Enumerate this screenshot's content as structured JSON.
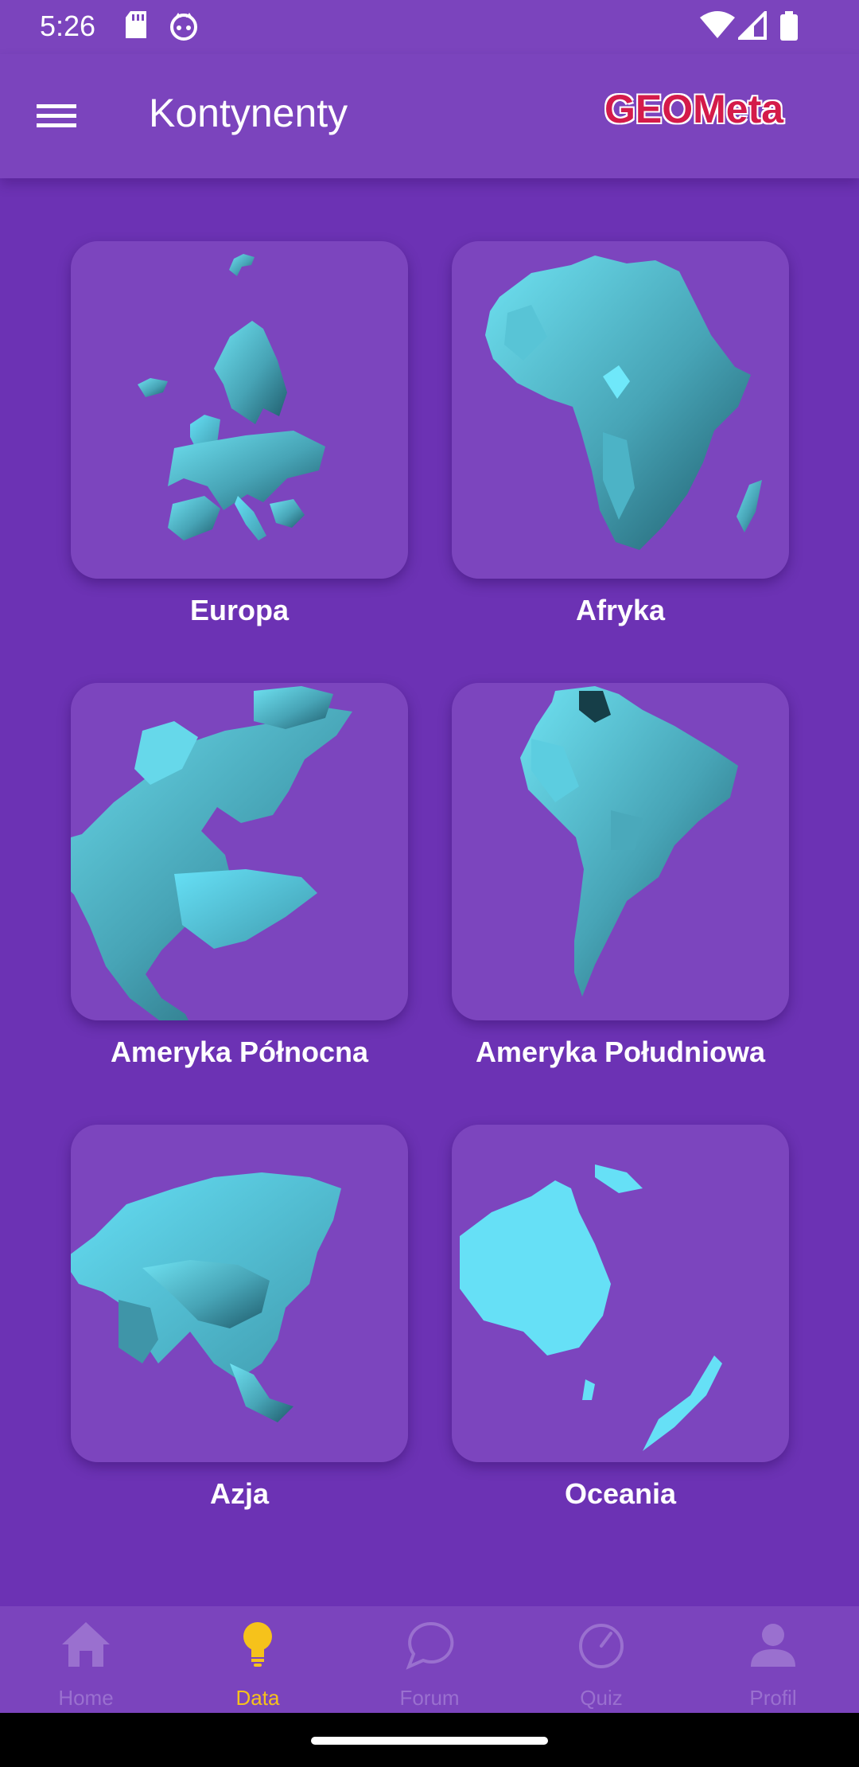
{
  "status_bar": {
    "time": "5:26"
  },
  "app_bar": {
    "title": "Kontynenty",
    "brand": "GEOMeta"
  },
  "continents": [
    {
      "label": "Europa"
    },
    {
      "label": "Afryka"
    },
    {
      "label": "Ameryka Północna"
    },
    {
      "label": "Ameryka Południowa"
    },
    {
      "label": "Azja"
    },
    {
      "label": "Oceania"
    }
  ],
  "bottom_nav": {
    "items": [
      {
        "label": "Home",
        "icon": "home-icon"
      },
      {
        "label": "Data",
        "icon": "lightbulb-icon",
        "active": true
      },
      {
        "label": "Forum",
        "icon": "chat-bubble-icon"
      },
      {
        "label": "Quiz",
        "icon": "timer-icon"
      },
      {
        "label": "Profil",
        "icon": "person-icon"
      }
    ]
  },
  "colors": {
    "background": "#6c32b4",
    "app_bar": "#7b44bd",
    "card": "#7c45be",
    "map_fill": "#5fc9d8",
    "active_nav": "#f6c21b",
    "inactive_nav": "#9a70cf",
    "brand": "#d41b4a"
  }
}
